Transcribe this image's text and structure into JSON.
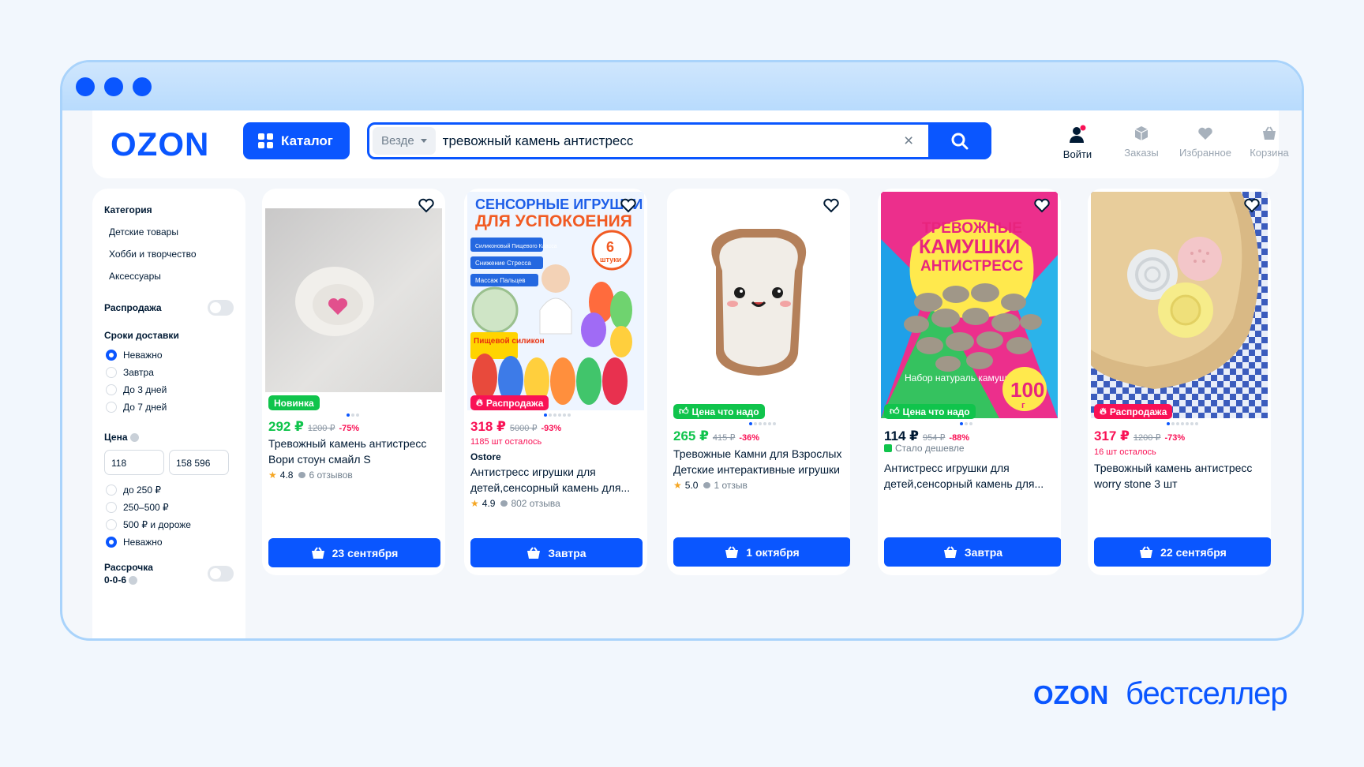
{
  "brand": "OZON",
  "colors": {
    "accent": "#0a56ff",
    "sale": "#f91155",
    "new_badge": "#10c44c",
    "price_green": "#10c44c"
  },
  "header": {
    "catalog_label": "Каталог",
    "search": {
      "scope": "Везде",
      "query": "тревожный камень антистресс"
    },
    "nav": [
      {
        "label": "Войти",
        "icon": "user-icon"
      },
      {
        "label": "Заказы",
        "icon": "box-icon"
      },
      {
        "label": "Избранное",
        "icon": "heart-icon"
      },
      {
        "label": "Корзина",
        "icon": "cart-icon"
      }
    ]
  },
  "sidebar": {
    "category_title": "Категория",
    "categories": [
      "Детские товары",
      "Хобби и творчество",
      "Аксессуары"
    ],
    "sale_label": "Распродажа",
    "delivery_title": "Сроки доставки",
    "delivery_options": [
      "Неважно",
      "Завтра",
      "До 3 дней",
      "До 7 дней"
    ],
    "price_title": "Цена",
    "price_from": "118",
    "price_to": "158 596",
    "price_options": [
      "до 250 ₽",
      "250–500 ₽",
      "500 ₽ и дороже",
      "Неважно"
    ],
    "installment_label": "Рассрочка",
    "installment_sub": "0-0-6"
  },
  "products": [
    {
      "badge": "Новинка",
      "price": "292 ₽",
      "old_price": "1200 ₽",
      "discount": "-75%",
      "title": "Тревожный камень антистресс Вори стоун смайл S",
      "rating": "4.8",
      "reviews": "6 отзывов",
      "button": "23 сентября"
    },
    {
      "image_text_1": "СЕНСОРНЫЕ ИГРУШКИ",
      "image_text_2": "ДЛЯ УСПОКОЕНИЯ",
      "image_pills": [
        "Силиконовый Пищевого Класса",
        "Снижение Стресса",
        "Массаж Пальцев"
      ],
      "image_count": "6",
      "image_count_label": "штуки",
      "image_food": "Пищевой силикон",
      "badge": "Распродажа",
      "price": "318 ₽",
      "old_price": "5000 ₽",
      "discount": "-93%",
      "left": "1185 шт осталось",
      "seller": "Ostore",
      "title": "Антистресс игрушки для детей,сенсорный камень для...",
      "rating": "4.9",
      "reviews": "802 отзыва",
      "button": "Завтра"
    },
    {
      "badge": "Цена что надо",
      "price": "265 ₽",
      "old_price": "415 ₽",
      "discount": "-36%",
      "title": "Тревожные Камни для Взрослых Детские интерактивные игрушки",
      "rating": "5.0",
      "reviews": "1 отзыв",
      "button": "1 октября"
    },
    {
      "image_text_1": "ТРЕВОЖНЫЕ",
      "image_text_2": "КАМУШКИ",
      "image_text_3": "АНТИСТРЕСС",
      "image_caption": "Набор натураль камушков",
      "image_weight": "100",
      "image_weight_unit": "г",
      "badge": "Цена что надо",
      "price": "114 ₽",
      "old_price": "954 ₽",
      "discount": "-88%",
      "note": "Стало дешевле",
      "title": "Антистресс игрушки для детей,сенсорный камень для...",
      "button": "Завтра"
    },
    {
      "badge": "Распродажа",
      "price": "317 ₽",
      "old_price": "1200 ₽",
      "discount": "-73%",
      "left": "16 шт осталось",
      "title": "Тревожный камень антистресс worry stone 3 шт",
      "button": "22 сентября"
    }
  ],
  "footer": {
    "brand": "OZON",
    "text": "бестселлер"
  }
}
